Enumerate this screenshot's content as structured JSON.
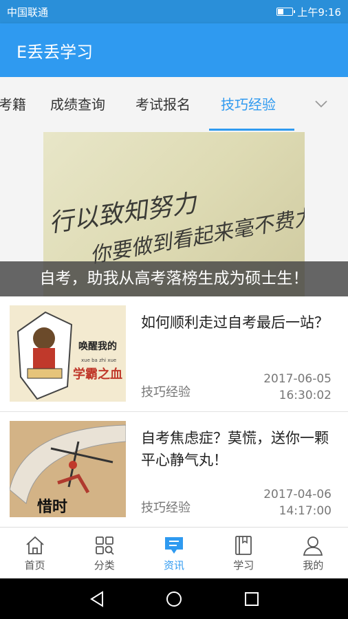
{
  "status_bar": {
    "carrier": "中国联通",
    "time": "上午9:16",
    "battery_level": 0.4
  },
  "app_bar": {
    "title": "E丢丢学习"
  },
  "tabs": {
    "items": [
      {
        "label": "考籍"
      },
      {
        "label": "成绩查询"
      },
      {
        "label": "考试报名"
      },
      {
        "label": "技巧经验",
        "active": true
      }
    ],
    "more_icon": "chevron-down-icon"
  },
  "banner": {
    "caption": "自考，助我从高考落榜生成为硕士生！",
    "image_text_1": "行以致知努力",
    "image_text_2": "你要做到看起来毫不费力"
  },
  "articles": [
    {
      "title": "如何顺利走过自考最后一站？",
      "category": "技巧经验",
      "date": "2017-06-05",
      "time": "16:30:02",
      "thumb_text": "唤醒我的",
      "thumb_subtext": "学霸之血",
      "thumb_pinyin": "xue ba zhi xue"
    },
    {
      "title": "自考焦虑症？莫慌，送你一颗平心静气丸！",
      "category": "技巧经验",
      "date": "2017-04-06",
      "time": "14:17:00",
      "thumb_text": "惜时"
    }
  ],
  "bottom_nav": [
    {
      "label": "首页",
      "icon": "home-icon"
    },
    {
      "label": "分类",
      "icon": "category-icon"
    },
    {
      "label": "资讯",
      "icon": "news-icon",
      "active": true
    },
    {
      "label": "学习",
      "icon": "book-icon"
    },
    {
      "label": "我的",
      "icon": "user-icon"
    }
  ],
  "colors": {
    "primary": "#2f9af0",
    "status_bar": "#2a8fd9",
    "text": "#222222",
    "muted": "#777777"
  }
}
